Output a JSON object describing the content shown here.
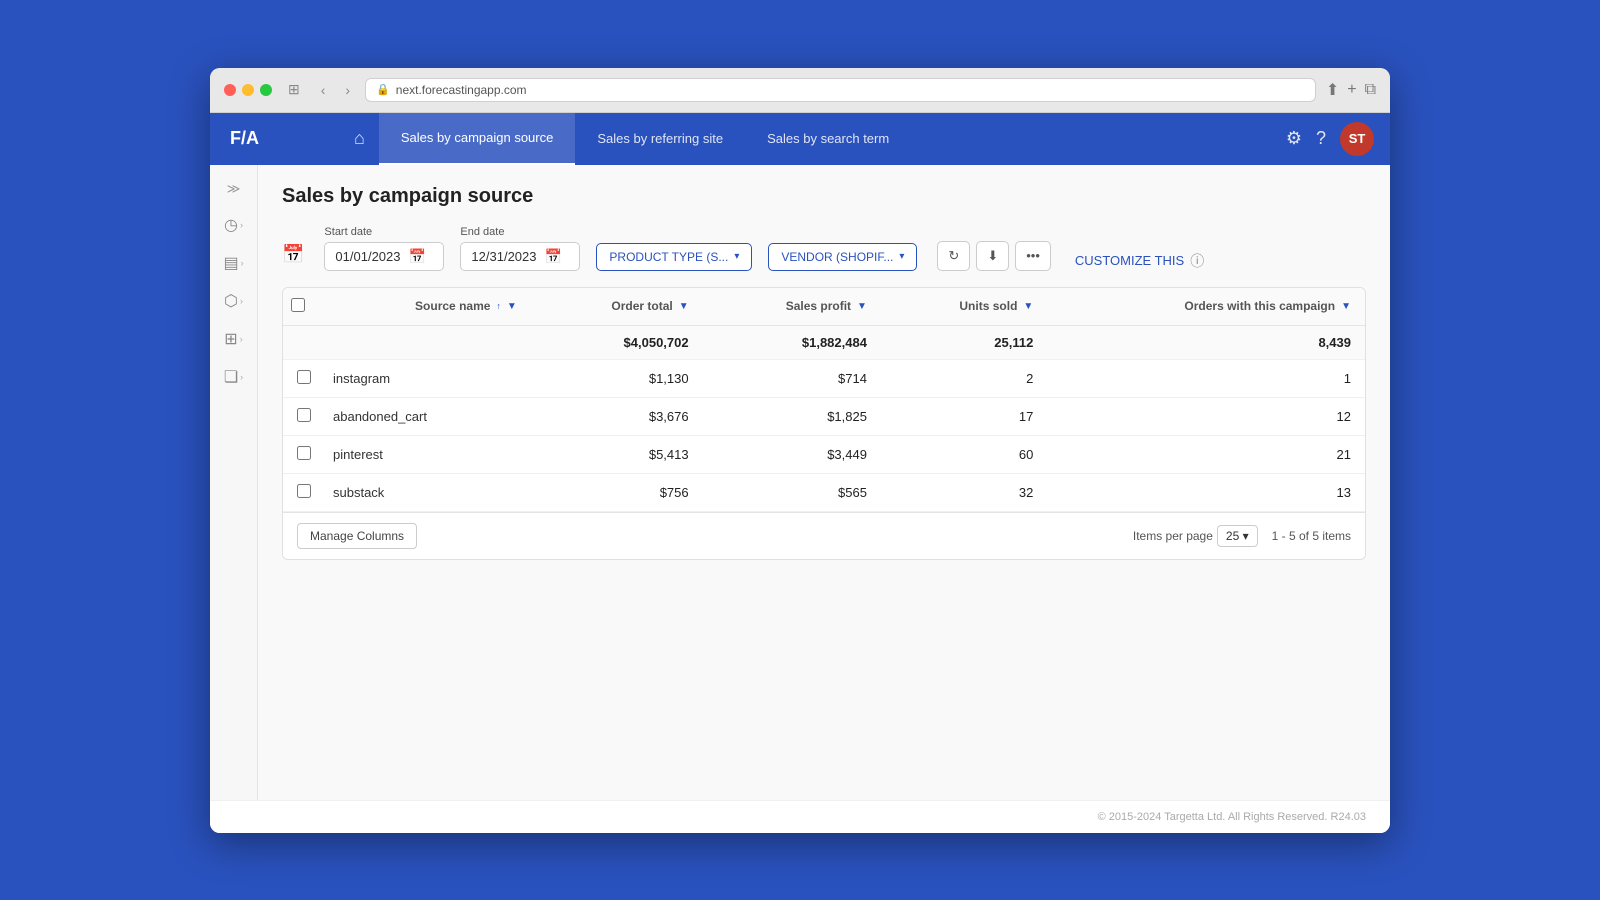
{
  "browser": {
    "url": "next.forecastingapp.com",
    "reload_label": "⟳"
  },
  "app": {
    "logo": "F/A",
    "nav_tabs": [
      {
        "label": "Sales by campaign source",
        "active": true
      },
      {
        "label": "Sales by referring site",
        "active": false
      },
      {
        "label": "Sales by search term",
        "active": false
      }
    ],
    "user_initials": "ST"
  },
  "filters": {
    "start_date_label": "Start date",
    "start_date_value": "01/01/2023",
    "end_date_label": "End date",
    "end_date_value": "12/31/2023",
    "product_type_btn": "PRODUCT TYPE (S...",
    "vendor_btn": "VENDOR (SHOPIF...",
    "customize_label": "CUSTOMIZE THIS"
  },
  "page": {
    "title": "Sales by campaign source"
  },
  "table": {
    "columns": [
      {
        "label": "Source name",
        "sortable": true,
        "filterable": true
      },
      {
        "label": "Order total",
        "sortable": false,
        "filterable": true
      },
      {
        "label": "Sales profit",
        "sortable": false,
        "filterable": true
      },
      {
        "label": "Units sold",
        "sortable": false,
        "filterable": true
      },
      {
        "label": "Orders with this campaign",
        "sortable": false,
        "filterable": true
      }
    ],
    "summary_row": {
      "order_total": "$4,050,702",
      "sales_profit": "$1,882,484",
      "units_sold": "25,112",
      "orders": "8,439"
    },
    "rows": [
      {
        "source": "instagram",
        "order_total": "$1,130",
        "sales_profit": "$714",
        "units_sold": "2",
        "orders": "1"
      },
      {
        "source": "abandoned_cart",
        "order_total": "$3,676",
        "sales_profit": "$1,825",
        "units_sold": "17",
        "orders": "12"
      },
      {
        "source": "pinterest",
        "order_total": "$5,413",
        "sales_profit": "$3,449",
        "units_sold": "60",
        "orders": "21"
      },
      {
        "source": "substack",
        "order_total": "$756",
        "sales_profit": "$565",
        "units_sold": "32",
        "orders": "13"
      }
    ],
    "manage_columns_label": "Manage Columns",
    "items_per_page_label": "Items per page",
    "items_per_page_value": "25",
    "pagination_text": "1 - 5 of 5 items"
  },
  "footer": {
    "copyright": "© 2015-2024 Targetta Ltd. All Rights Reserved. R24.03"
  }
}
